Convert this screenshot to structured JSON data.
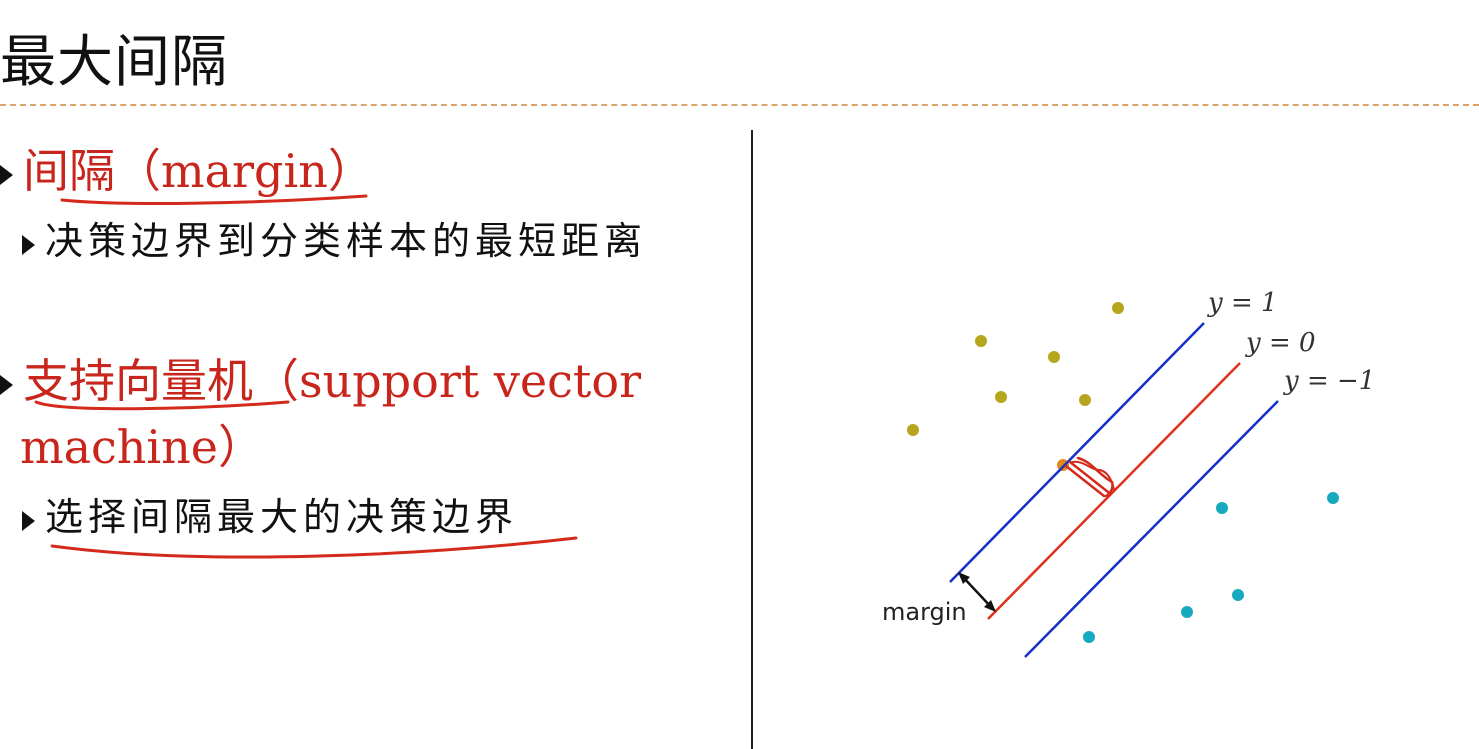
{
  "slide": {
    "title": "最大间隔"
  },
  "left": {
    "bullets": [
      {
        "heading": "间隔（margin）",
        "sub": "决策边界到分类样本的最短距离"
      },
      {
        "heading_line1": "支持向量机（support vector",
        "heading_line2": "machine）",
        "sub": "选择间隔最大的决策边界"
      }
    ]
  },
  "diagram": {
    "line_labels": [
      "y = 1",
      "y = 0",
      "y = −1"
    ],
    "margin_label": "margin",
    "colors": {
      "class_a": "#b5a61e",
      "class_b": "#17a9c0",
      "margin_lines": "#1530c8",
      "decision_line": "#e0311f",
      "annotation": "#d42a1c"
    }
  }
}
